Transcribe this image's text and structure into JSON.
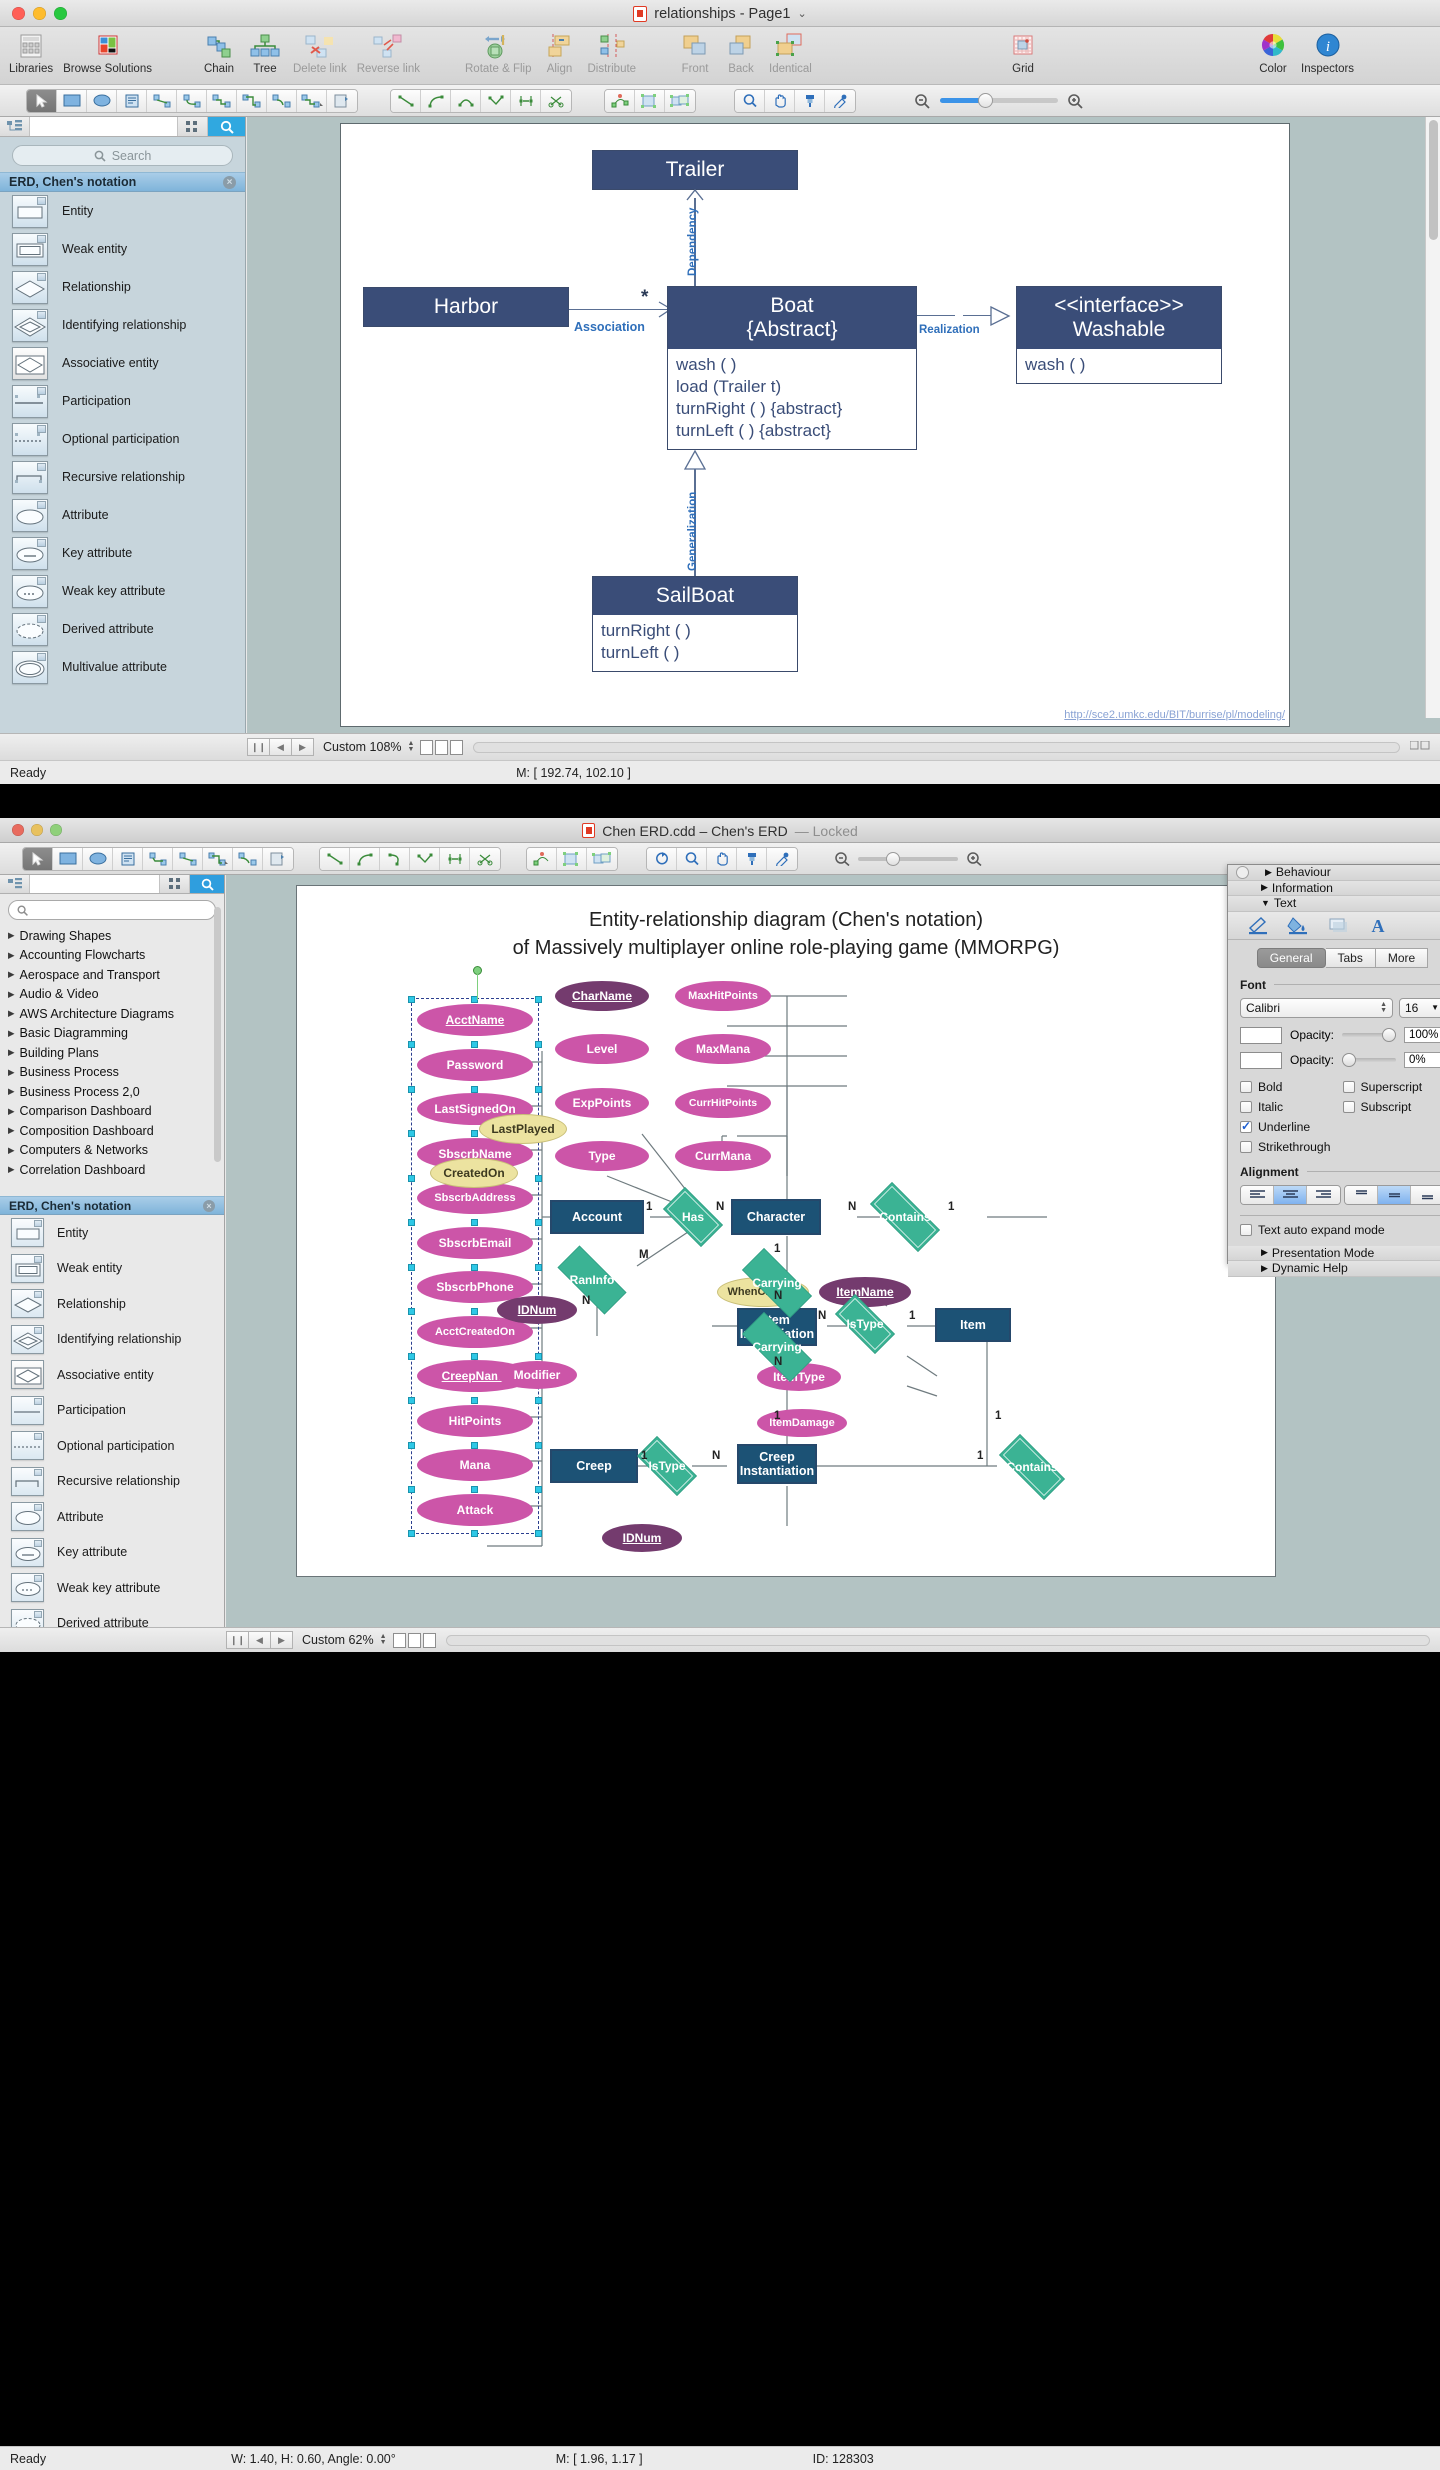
{
  "window1": {
    "title": "relationships - Page1",
    "ribbon": [
      {
        "label": "Libraries",
        "icon": "libraries-icon",
        "dim": false
      },
      {
        "label": "Browse Solutions",
        "icon": "browse-solutions-icon",
        "dim": false
      },
      {
        "label": "Chain",
        "icon": "chain-icon",
        "dim": false
      },
      {
        "label": "Tree",
        "icon": "tree-icon",
        "dim": false
      },
      {
        "label": "Delete link",
        "icon": "delete-link-icon",
        "dim": true
      },
      {
        "label": "Reverse link",
        "icon": "reverse-link-icon",
        "dim": true
      },
      {
        "label": "Rotate & Flip",
        "icon": "rotate-flip-icon",
        "dim": true
      },
      {
        "label": "Align",
        "icon": "align-icon",
        "dim": true
      },
      {
        "label": "Distribute",
        "icon": "distribute-icon",
        "dim": true
      },
      {
        "label": "Front",
        "icon": "bring-front-icon",
        "dim": true
      },
      {
        "label": "Back",
        "icon": "send-back-icon",
        "dim": true
      },
      {
        "label": "Identical",
        "icon": "identical-icon",
        "dim": true
      },
      {
        "label": "Grid",
        "icon": "grid-icon",
        "dim": false
      },
      {
        "label": "Color",
        "icon": "color-wheel-icon",
        "dim": false
      },
      {
        "label": "Inspectors",
        "icon": "inspectors-info-icon",
        "dim": false
      }
    ],
    "library": {
      "search_placeholder": "Search",
      "title": "ERD, Chen's notation",
      "items": [
        {
          "label": "Entity",
          "shape": "rect"
        },
        {
          "label": "Weak entity",
          "shape": "double-rect"
        },
        {
          "label": "Relationship",
          "shape": "diamond"
        },
        {
          "label": "Identifying relationship",
          "shape": "double-diamond"
        },
        {
          "label": "Associative entity",
          "shape": "rect-diamond"
        },
        {
          "label": "Participation",
          "shape": "line"
        },
        {
          "label": "Optional participation",
          "shape": "dotted-line"
        },
        {
          "label": "Recursive relationship",
          "shape": "recursive-line"
        },
        {
          "label": "Attribute",
          "shape": "ellipse"
        },
        {
          "label": "Key attribute",
          "shape": "ellipse-underline"
        },
        {
          "label": "Weak key attribute",
          "shape": "ellipse-dashed-underline"
        },
        {
          "label": "Derived attribute",
          "shape": "dashed-ellipse"
        },
        {
          "label": "Multivalue attribute",
          "shape": "double-ellipse"
        }
      ]
    },
    "diagram": {
      "classes": [
        {
          "name": "trailer",
          "title": "Trailer",
          "members": []
        },
        {
          "name": "harbor",
          "title": "Harbor",
          "members": []
        },
        {
          "name": "boat",
          "title": "Boat\n{Abstract}",
          "title_line1": "Boat",
          "title_line2": "{Abstract}",
          "members": [
            "wash ( )",
            "load (Trailer t)",
            "turnRight ( ) {abstract}",
            "turnLeft ( ) {abstract}"
          ]
        },
        {
          "name": "washable",
          "title_line1": "<<interface>>",
          "title_line2": "Washable",
          "members": [
            "wash ( )"
          ]
        },
        {
          "name": "sailboat",
          "title": "SailBoat",
          "members": [
            "turnRight ( )",
            "turnLeft ( )"
          ]
        }
      ],
      "links": [
        {
          "label": "Dependency",
          "from": "boat",
          "to": "trailer"
        },
        {
          "label": "Association",
          "from": "harbor",
          "to": "boat",
          "multiplicity": "*"
        },
        {
          "label": "Realization",
          "from": "boat",
          "to": "washable"
        },
        {
          "label": "Generalization",
          "from": "sailboat",
          "to": "boat"
        }
      ],
      "watermark": "http://sce2.umkc.edu/BIT/burrise/pl/modeling/"
    },
    "status": {
      "zoom": "Custom 108%",
      "ready": "Ready",
      "mouse": "M: [ 192.74, 102.10 ]"
    }
  },
  "window2": {
    "title": "Chen ERD.cdd – Chen's ERD",
    "title_state": "— Locked",
    "search_placeholder": "",
    "tree": [
      {
        "label": "Drawing Shapes"
      },
      {
        "label": "Accounting Flowcharts"
      },
      {
        "label": "Aerospace and Transport"
      },
      {
        "label": "Audio & Video"
      },
      {
        "label": "AWS Architecture Diagrams"
      },
      {
        "label": "Basic Diagramming"
      },
      {
        "label": "Building Plans"
      },
      {
        "label": "Business Process"
      },
      {
        "label": "Business Process 2,0"
      },
      {
        "label": "Comparison Dashboard"
      },
      {
        "label": "Composition Dashboard"
      },
      {
        "label": "Computers & Networks"
      },
      {
        "label": "Correlation Dashboard"
      }
    ],
    "library": {
      "title": "ERD, Chen's notation",
      "items": [
        {
          "label": "Entity"
        },
        {
          "label": "Weak entity"
        },
        {
          "label": "Relationship"
        },
        {
          "label": "Identifying relationship"
        },
        {
          "label": "Associative entity"
        },
        {
          "label": "Participation"
        },
        {
          "label": "Optional participation"
        },
        {
          "label": "Recursive relationship"
        },
        {
          "label": "Attribute"
        },
        {
          "label": "Key attribute"
        },
        {
          "label": "Weak key attribute"
        },
        {
          "label": "Derived attribute"
        }
      ]
    },
    "erd": {
      "title_line1": "Entity-relationship diagram (Chen's notation)",
      "title_line2": "of Massively multiplayer online role-playing game (MMORPG)",
      "entities": [
        {
          "name": "account",
          "label": "Account"
        },
        {
          "name": "character",
          "label": "Character"
        },
        {
          "name": "item-instantiation",
          "label": "Item\nInstantiation",
          "l1": "Item",
          "l2": "Instantiation"
        },
        {
          "name": "item",
          "label": "Item"
        },
        {
          "name": "creep",
          "label": "Creep"
        },
        {
          "name": "creep-instantiation",
          "label": "Creep\nInstantiation",
          "l1": "Creep",
          "l2": "Instantiation"
        }
      ],
      "relationships": [
        {
          "name": "has",
          "label": "Has",
          "identifying": true
        },
        {
          "name": "contains-top",
          "label": "Contains",
          "identifying": true
        },
        {
          "name": "raninfo",
          "label": "RanInfo",
          "identifying": false
        },
        {
          "name": "carrying-1",
          "label": "Carrying",
          "identifying": false
        },
        {
          "name": "istype-1",
          "label": "IsType",
          "identifying": true
        },
        {
          "name": "carrying-2",
          "label": "Carrying",
          "identifying": false
        },
        {
          "name": "istype-2",
          "label": "IsType",
          "identifying": true
        },
        {
          "name": "contains-bottom",
          "label": "Contains",
          "identifying": true
        }
      ],
      "attributes_selected": [
        "AcctName",
        "Password",
        "LastSignedOn",
        "SbscrbName",
        "SbscrbAddress",
        "SbscrbEmail",
        "SbscrbPhone",
        "AcctCreatedOn",
        "CreepName",
        "HitPoints",
        "Mana",
        "Attack"
      ],
      "attributes_other": [
        "CharName",
        "MaxHitPoints",
        "Level",
        "MaxMana",
        "ExpPoints",
        "CurrHitPoints",
        "Type",
        "CurrMana",
        "LastPlayed",
        "CreatedOn",
        "IDNum",
        "WhenCreated",
        "ItemName",
        "Modifier",
        "ItemType",
        "ItemDamage",
        "IDNum2"
      ],
      "cardinalities": [
        "1",
        "N",
        "N",
        "1",
        "1",
        "M",
        "N",
        "N",
        "N",
        "1",
        "N",
        "1",
        "1",
        "N",
        "1",
        "1"
      ]
    },
    "inspector": {
      "sections": [
        "Behaviour",
        "Information",
        "Text"
      ],
      "expanded": "Text",
      "icons": [
        "pen-icon",
        "fill-icon",
        "shadow-icon",
        "text-icon"
      ],
      "tabs": [
        "General",
        "Tabs",
        "More"
      ],
      "active_tab": "General",
      "font_section": "Font",
      "font_name": "Calibri",
      "font_size": "16",
      "opacity_label_1": "Opacity:",
      "opacity_value_1": "100%",
      "opacity_label_2": "Opacity:",
      "opacity_value_2": "0%",
      "checkboxes": [
        {
          "label": "Bold",
          "checked": false
        },
        {
          "label": "Superscript",
          "checked": false
        },
        {
          "label": "Italic",
          "checked": false
        },
        {
          "label": "Subscript",
          "checked": false
        },
        {
          "label": "Underline",
          "checked": true
        },
        {
          "label": "Strikethrough",
          "checked": false
        }
      ],
      "alignment_label": "Alignment",
      "auto_expand_label": "Text auto expand mode",
      "auto_expand_checked": false,
      "footer_sections": [
        "Presentation Mode",
        "Dynamic Help"
      ]
    },
    "status": {
      "zoom": "Custom 62%",
      "ready": "Ready",
      "dims": "W: 1.40, H: 0.60, Angle: 0.00°",
      "mouse": "M: [ 1.96, 1.17 ]",
      "id": "ID: 128303"
    }
  },
  "colors": {
    "uml_header": "#3a4d78",
    "uml_text": "#3a4d78",
    "link_label": "#2f6fba",
    "erd_entity": "#1c5275",
    "erd_relationship": "#3bb394",
    "erd_attr_pink": "#cc55a8",
    "erd_attr_purple": "#743b6e",
    "erd_attr_yellow": "#ece3a0",
    "library_header": "#7fb4da",
    "selection": "#2ec8e6"
  }
}
